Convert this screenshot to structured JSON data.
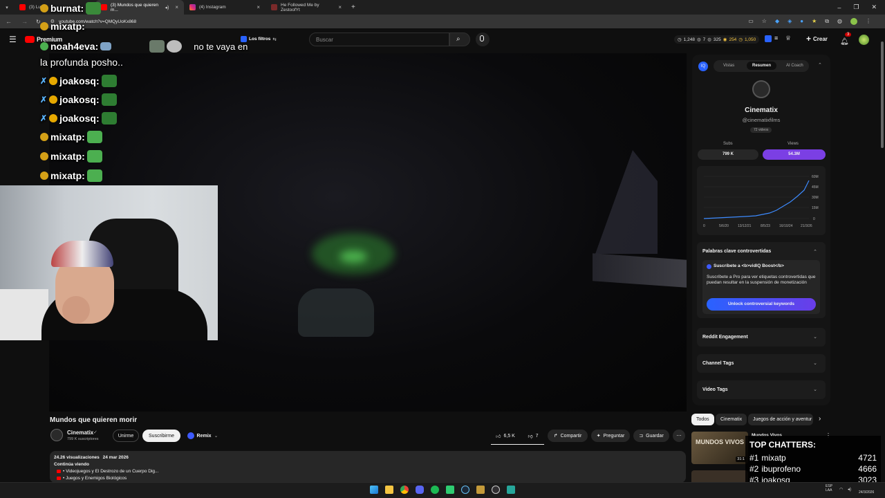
{
  "browser": {
    "tabs": [
      {
        "label": "(3) Ludo",
        "icon": "youtube-icon",
        "active": false
      },
      {
        "label": "(3) Mundos que quieren m...",
        "icon": "youtube-icon",
        "active": true
      },
      {
        "label": "(4) Instagram",
        "icon": "instagram-icon",
        "active": false
      },
      {
        "label": "He Followed Me by ZestoofYt",
        "icon": "music-icon",
        "active": false
      }
    ],
    "url": "youtube.com/watch?v=QMQyUoKx868"
  },
  "youtube": {
    "logo_label": "Premium",
    "filter_label": "Los filtros",
    "search_placeholder": "Buscar",
    "stats": [
      "1,248",
      "7",
      "325",
      "254",
      "1,050"
    ],
    "create_label": "Crear",
    "notification_count": "3"
  },
  "chat": [
    {
      "user": "burnat:",
      "text": ""
    },
    {
      "user": "mixatp:",
      "text": ""
    },
    {
      "user": "noah4eva:",
      "text": "no te vaya en"
    },
    {
      "user": "",
      "text": "la profunda posho.."
    },
    {
      "user": "joakosq:",
      "text": ""
    },
    {
      "user": "joakosq:",
      "text": ""
    },
    {
      "user": "joakosq:",
      "text": ""
    },
    {
      "user": "mixatp:",
      "text": ""
    },
    {
      "user": "mixatp:",
      "text": ""
    },
    {
      "user": "mixatp:",
      "text": ""
    }
  ],
  "video": {
    "title": "Mundos que quieren morir",
    "channel": "Cinematix",
    "subscribers": "799 K suscriptores",
    "join_label": "Unirme",
    "subscribe_label": "Suscribirme",
    "remix_label": "Remix",
    "likes": "6,5 K",
    "dislikes": "7",
    "share_label": "Compartir",
    "ask_label": "Preguntar",
    "save_label": "Guardar",
    "views": "24.26",
    "views_suffix": "visualizaciones",
    "date": "24 mar 2026",
    "continue_label": "Continúa viendo",
    "continue_items": [
      "• Videojuegos y El Destrozo de un Cuerpo Dig...",
      "• Juegos y Enemigos Biológicos"
    ]
  },
  "vidiq": {
    "tabs": [
      "Vistas",
      "Resumen",
      "AI Coach"
    ],
    "active_tab": "Resumen",
    "channel_name": "Cinematix",
    "handle": "@cinematixfilms",
    "video_count": "72 videos",
    "subs_label": "Subs",
    "views_label": "Views",
    "subs_value": "799 K",
    "views_value": "54.3M",
    "chart_y_ticks": [
      "60M",
      "45M",
      "30M",
      "15M",
      "0"
    ],
    "chart_x_ticks": [
      "0",
      "5/6/20",
      "13/12/21",
      "8/5/23",
      "16/10/24",
      "21/3/26"
    ],
    "keywords_title": "Palabras clave controvertidas",
    "boost_title": "Suscríbete a <b>vidIQ Boost</b>",
    "boost_text": "Suscríbete a Pro para ver etiquetas controvertidas que puedan resultar en la suspensión de monetización",
    "unlock_label": "Unlock controversial keywords",
    "reddit_label": "Reddit Engagement",
    "tags_label": "Channel Tags",
    "video_tags_label": "Video Tags",
    "accent": "#7b3fe4",
    "unlock_color": "#3d5afe"
  },
  "chips": [
    "Todos",
    "Cinematix",
    "Juegos de acción y aventur"
  ],
  "suggestion": {
    "title": "Mundos Vivos",
    "thumb_text": "MUNDOS VIVOS",
    "duration": "31:1"
  },
  "top_chatters": {
    "title": "TOP CHATTERS:",
    "rows": [
      {
        "rank": "#1",
        "name": "mixatp",
        "count": "4721"
      },
      {
        "rank": "#2",
        "name": "ibuprofeno",
        "count": "4666"
      },
      {
        "rank": "#3",
        "name": "joakosq",
        "count": "3023"
      }
    ]
  },
  "taskbar": {
    "lang": "ESP",
    "lang2": "LAA",
    "date": "24/3/2026"
  }
}
